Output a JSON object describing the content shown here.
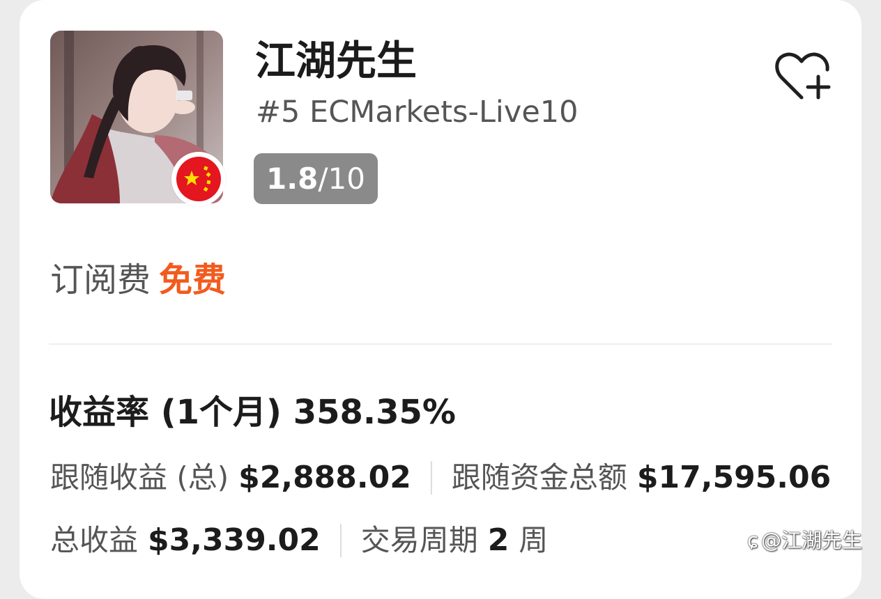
{
  "trader": {
    "name": "江湖先生",
    "rank_account": "#5 ECMarkets-Live10",
    "score_value": "1.8",
    "score_total": "/10",
    "country_flag_icon": "china-flag-icon"
  },
  "follow_button": {
    "icon": "heart-plus-icon"
  },
  "subscription": {
    "label": "订阅费",
    "value": "免费",
    "value_color": "#f25b1e"
  },
  "return_rate": {
    "text": "收益率 (1个月) 358.35%"
  },
  "stats": {
    "follow_profit_label": "跟随收益 (总)",
    "follow_profit_value": "$2,888.02",
    "follow_funds_label": "跟随资金总额",
    "follow_funds_value": "$17,595.06",
    "total_profit_label": "总收益",
    "total_profit_value": "$3,339.02",
    "trade_cycle_label": "交易周期",
    "trade_cycle_value": "2",
    "trade_cycle_unit": "周"
  },
  "watermark": {
    "text": "@江湖先生",
    "icon": "zhihu-logo-icon"
  }
}
